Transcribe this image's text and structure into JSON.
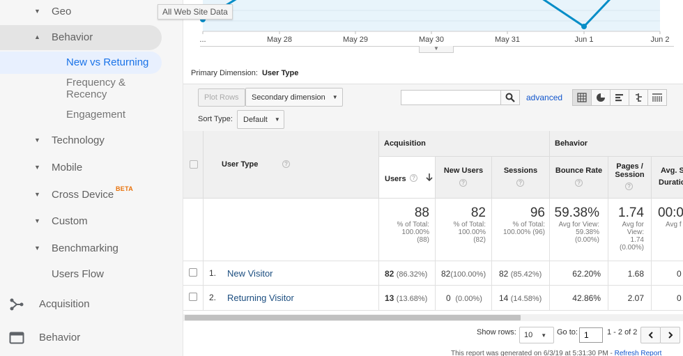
{
  "sidebar": {
    "geo": "Geo",
    "behavior": "Behavior",
    "new_vs_returning": "New vs Returning",
    "frequency_recency_line1": "Frequency &",
    "frequency_recency_line2": "Recency",
    "engagement": "Engagement",
    "technology": "Technology",
    "mobile": "Mobile",
    "cross_device": "Cross Device",
    "beta": "BETA",
    "custom": "Custom",
    "benchmarking": "Benchmarking",
    "users_flow": "Users Flow",
    "acquisition": "Acquisition",
    "behavior_main": "Behavior"
  },
  "chart": {
    "tooltip": "All Web Site Data",
    "x_ticks": [
      "...",
      "May 28",
      "May 29",
      "May 30",
      "May 31",
      "Jun 1",
      "Jun 2"
    ],
    "line_color": "#058dc7"
  },
  "controls": {
    "primary_dimension_label": "Primary Dimension:",
    "primary_dimension_value": "User Type",
    "plot_rows": "Plot Rows",
    "secondary_dimension": "Secondary dimension",
    "search_placeholder": "",
    "advanced": "advanced",
    "sort_type_label": "Sort Type:",
    "sort_type_value": "Default"
  },
  "table": {
    "headers": {
      "user_type": "User Type",
      "acquisition": "Acquisition",
      "behavior": "Behavior",
      "users": "Users",
      "new_users": "New Users",
      "sessions": "Sessions",
      "bounce_rate": "Bounce Rate",
      "pages_session_1": "Pages /",
      "pages_session_2": "Session",
      "avg_session_1": "Avg. S",
      "avg_session_2": "Duratio"
    },
    "totals": {
      "users": {
        "big": "88",
        "l1": "% of Total:",
        "l2": "100.00%",
        "l3": "(88)"
      },
      "new_users": {
        "big": "82",
        "l1": "% of Total:",
        "l2": "100.00%",
        "l3": "(82)"
      },
      "sessions": {
        "big": "96",
        "l1": "% of Total:",
        "l2": "100.00% (96)"
      },
      "bounce_rate": {
        "big": "59.38%",
        "l1": "Avg for View:",
        "l2": "59.38%",
        "l3": "(0.00%)"
      },
      "pages_session": {
        "big": "1.74",
        "l1": "Avg for",
        "l2": "View:",
        "l3": "1.74",
        "l4": "(0.00%)"
      },
      "avg_session": {
        "big": "00:0",
        "l1": "Avg f"
      }
    },
    "rows": [
      {
        "num": "1.",
        "user_type": "New Visitor",
        "users": "82",
        "users_pct": "(86.32%)",
        "new_users": "82",
        "new_users_pct": "(100.00%)",
        "sessions": "82",
        "sessions_pct": "(85.42%)",
        "bounce_rate": "62.20%",
        "pages_session": "1.68",
        "avg_session": "0"
      },
      {
        "num": "2.",
        "user_type": "Returning Visitor",
        "users": "13",
        "users_pct": "(13.68%)",
        "new_users": "0",
        "new_users_pct": "(0.00%)",
        "sessions": "14",
        "sessions_pct": "(14.58%)",
        "bounce_rate": "42.86%",
        "pages_session": "2.07",
        "avg_session": "0"
      }
    ]
  },
  "pager": {
    "show_rows_label": "Show rows:",
    "show_rows_value": "10",
    "goto_label": "Go to:",
    "goto_value": "1",
    "range": "1 - 2 of 2"
  },
  "footer": {
    "note": "This report was generated on 6/3/19 at 5:31:30 PM - ",
    "refresh": "Refresh Report"
  }
}
